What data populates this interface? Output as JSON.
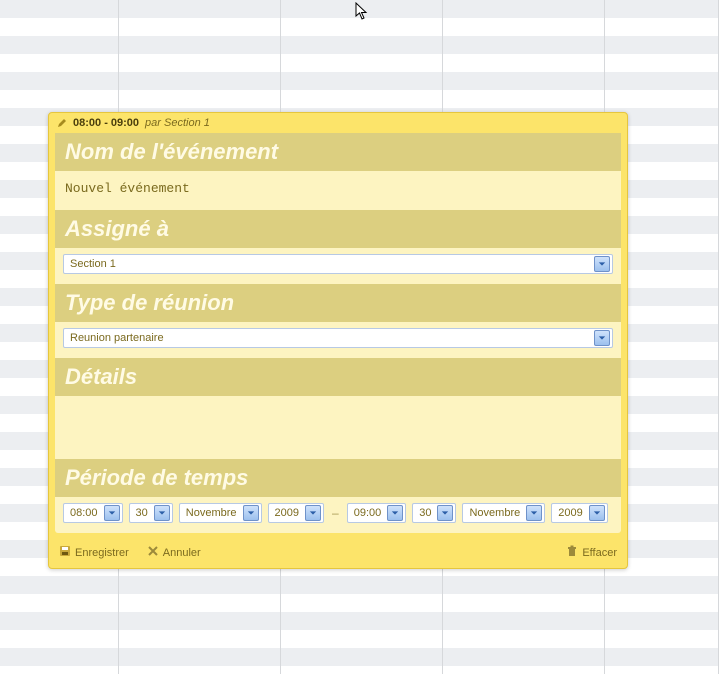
{
  "header": {
    "time_range": "08:00 - 09:00",
    "author_prefix": "par",
    "author": "Section 1"
  },
  "sections": {
    "name_label": "Nom de l'événement",
    "name_value": "Nouvel événement",
    "assigned_label": "Assigné à",
    "assigned_value": "Section 1",
    "meeting_type_label": "Type de réunion",
    "meeting_type_value": "Reunion partenaire",
    "details_label": "Détails",
    "details_value": "",
    "period_label": "Période de temps"
  },
  "period": {
    "start_hour": "08:00",
    "start_day": "30",
    "start_month": "Novembre",
    "start_year": "2009",
    "dash": "–",
    "end_hour": "09:00",
    "end_day": "30",
    "end_month": "Novembre",
    "end_year": "2009"
  },
  "footer": {
    "save": "Enregistrer",
    "cancel": "Annuler",
    "delete": "Effacer"
  }
}
